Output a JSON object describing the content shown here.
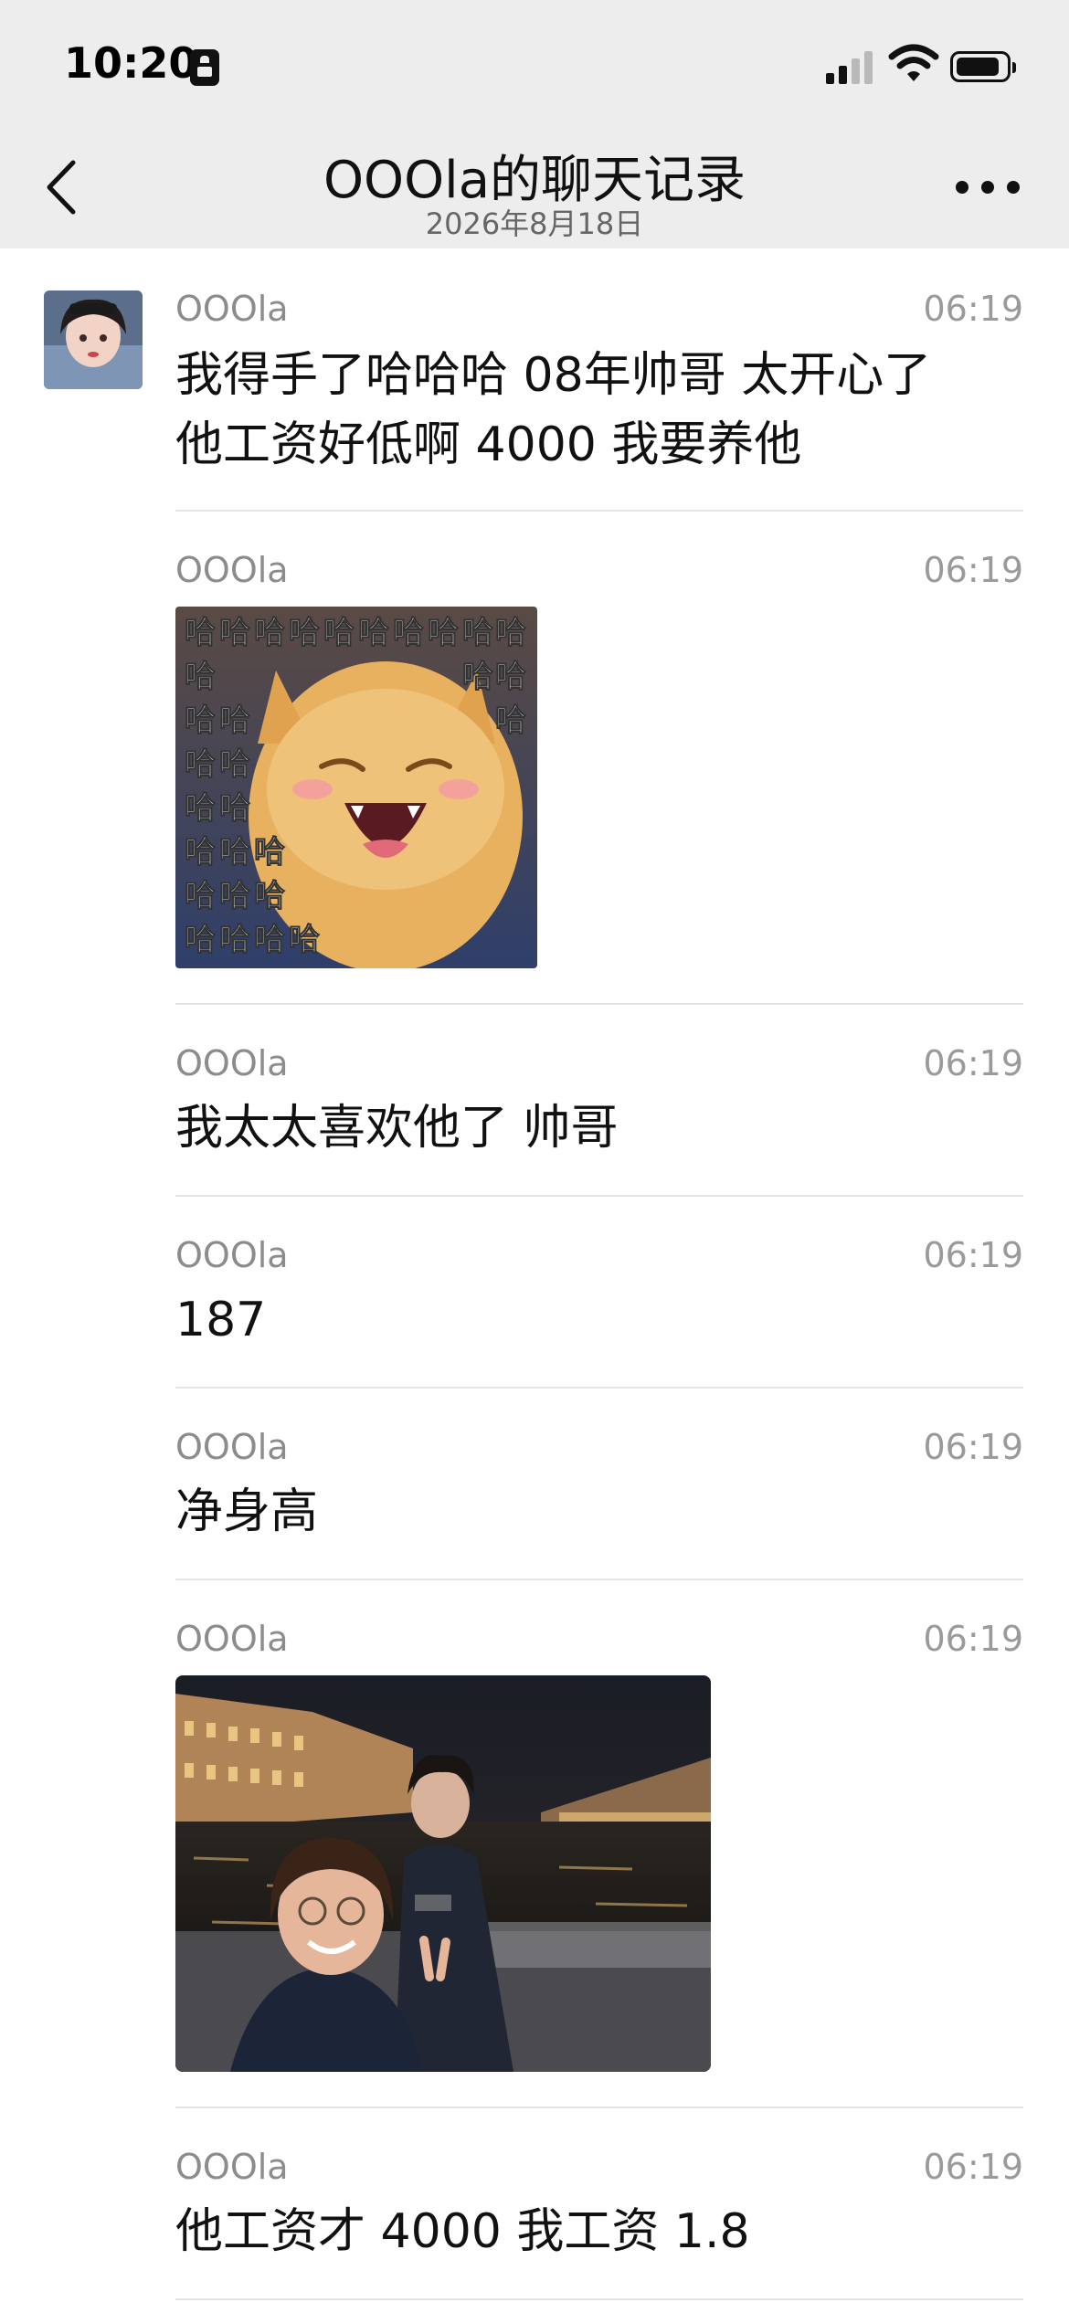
{
  "status_bar": {
    "time": "10:20"
  },
  "nav": {
    "title": "OOOla的聊天记录",
    "subtitle": "2026年8月18日"
  },
  "messages": [
    {
      "sender": "OOOla",
      "time": "06:19",
      "lines": [
        "我得手了哈哈哈 08年帅哥 太开心了",
        "他工资好低啊 4000 我要养他"
      ]
    },
    {
      "sender": "OOOla",
      "time": "06:19",
      "image": "laughing-cat-sticker",
      "sticker_text": "哈"
    },
    {
      "sender": "OOOla",
      "time": "06:19",
      "text": "我太太喜欢他了 帅哥"
    },
    {
      "sender": "OOOla",
      "time": "06:19",
      "text": "187"
    },
    {
      "sender": "OOOla",
      "time": "06:19",
      "text": "净身高"
    },
    {
      "sender": "OOOla",
      "time": "06:19",
      "image": "night-river-selfie-photo"
    },
    {
      "sender": "OOOla",
      "time": "06:19",
      "text": "他工资才 4000 我工资 1.8"
    }
  ]
}
